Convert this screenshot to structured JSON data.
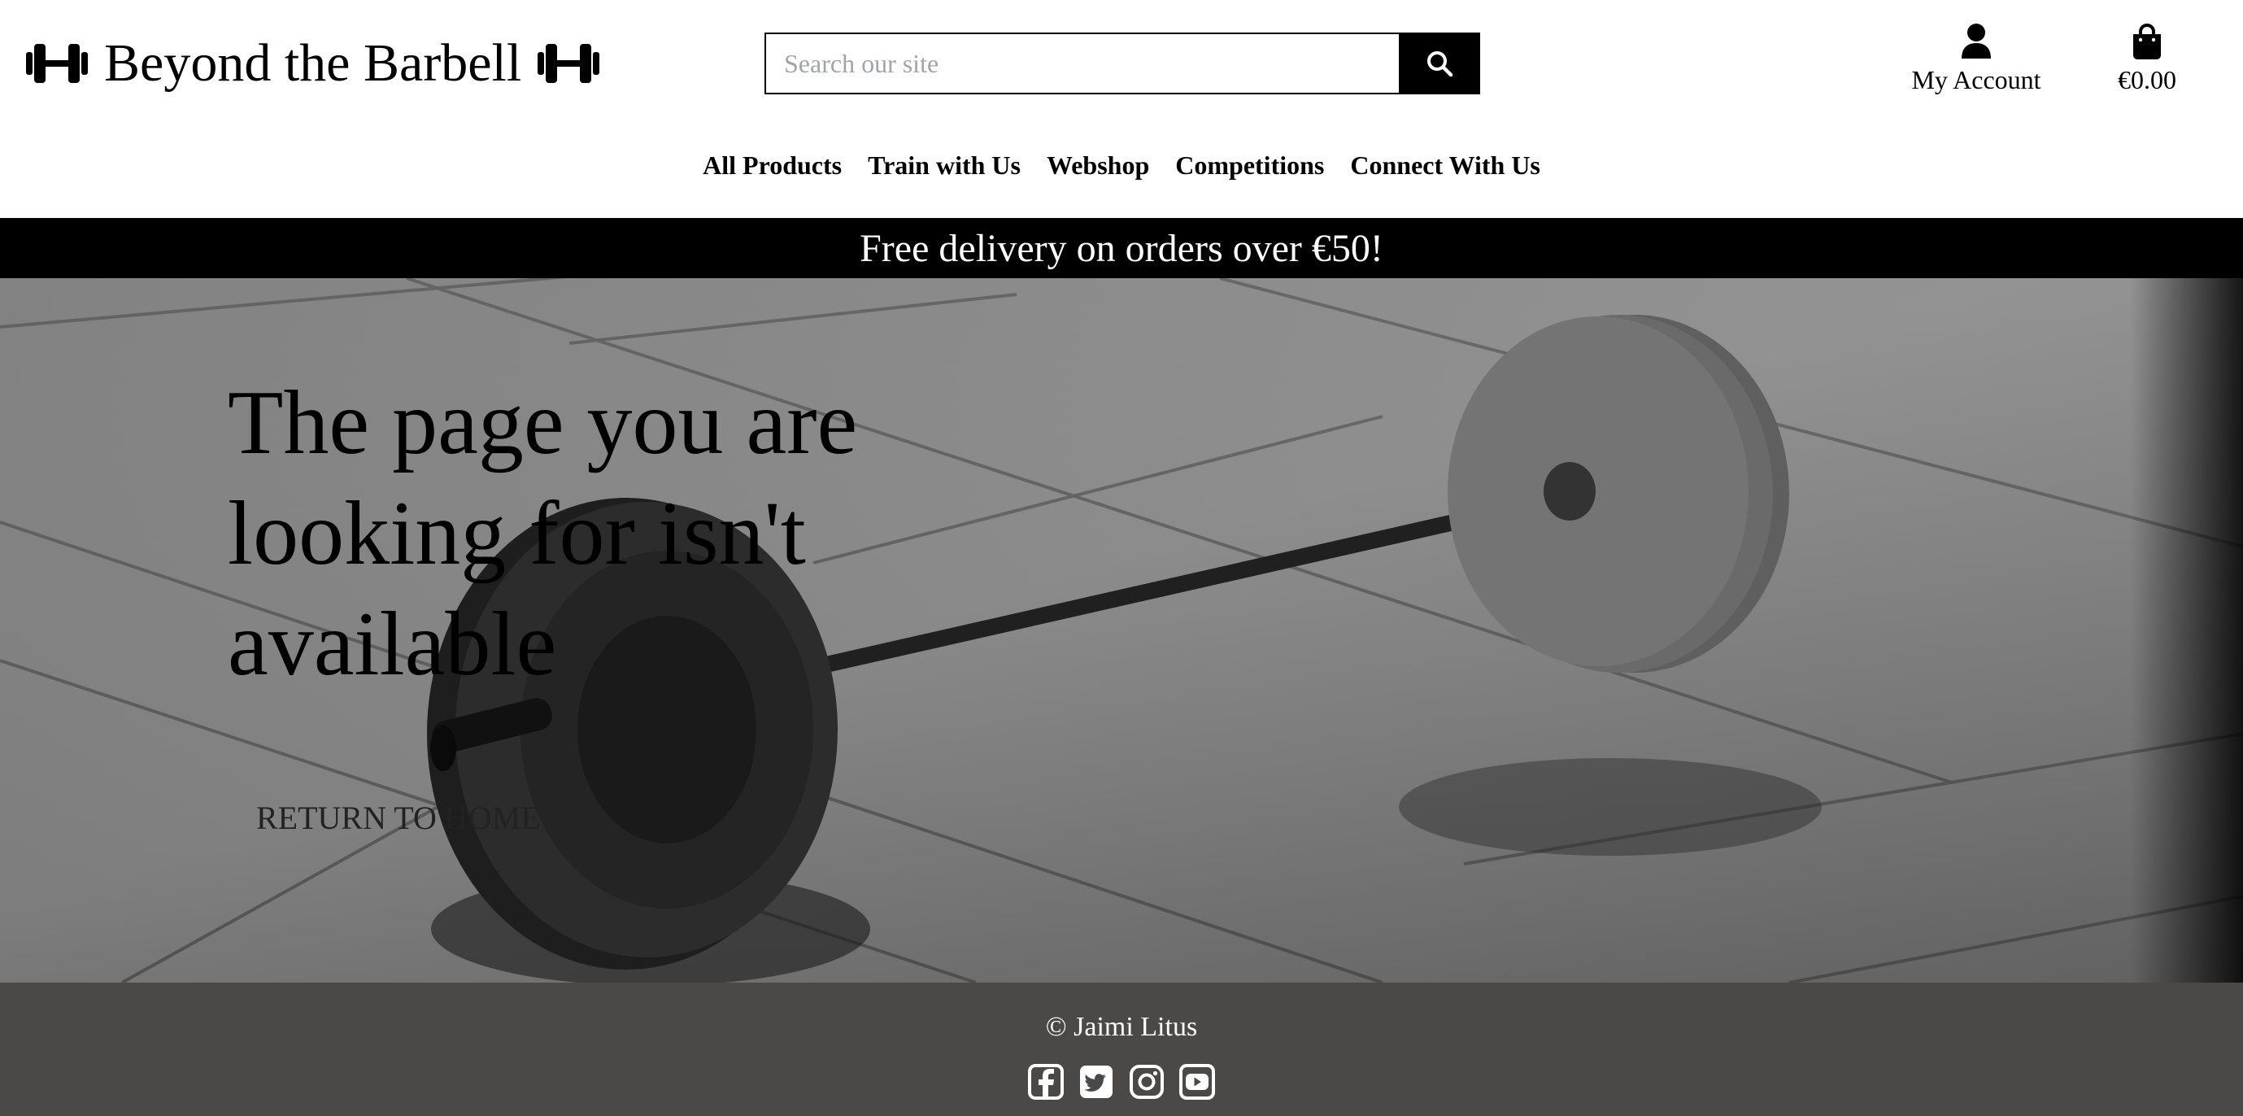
{
  "header": {
    "brand": "Beyond the Barbell",
    "search_placeholder": "Search our site",
    "account_label": "My Account",
    "cart_total": "€0.00"
  },
  "nav": {
    "items": [
      {
        "label": "All Products"
      },
      {
        "label": "Train with Us"
      },
      {
        "label": "Webshop"
      },
      {
        "label": "Competitions"
      },
      {
        "label": "Connect With Us"
      }
    ]
  },
  "banner": {
    "text": "Free delivery on orders over €50!"
  },
  "hero": {
    "title": "The page you are looking for isn't available",
    "return_label": "RETURN TO HOME"
  },
  "footer": {
    "copyright": "© Jaimi Litus",
    "social_icons": [
      "facebook-icon",
      "twitter-icon",
      "instagram-icon",
      "youtube-icon"
    ]
  },
  "colors": {
    "banner_bg": "#000000",
    "footer_bg": "#4b4848",
    "search_button_bg": "#000000"
  }
}
